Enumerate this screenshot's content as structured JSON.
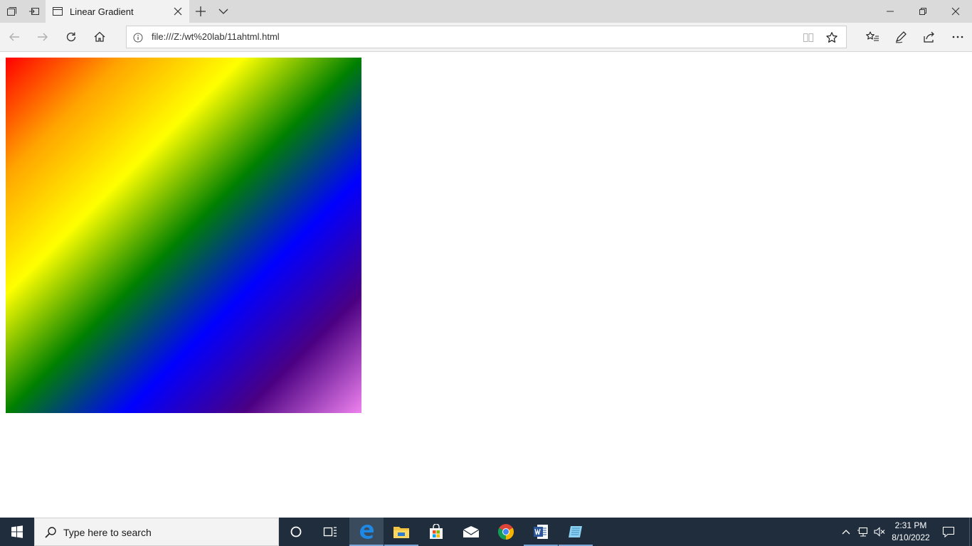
{
  "browser": {
    "tab": {
      "title": "Linear Gradient"
    },
    "address_bar": {
      "url": "file:///Z:/wt%20lab/11ahtml.html"
    }
  },
  "page": {
    "gradient_box": {
      "direction": "to bottom right",
      "colors": [
        "#ff0000",
        "#ffa500",
        "#ffff00",
        "#008000",
        "#0000ff",
        "#4b0082",
        "#ee82ee"
      ]
    }
  },
  "taskbar": {
    "search_placeholder": "Type here to search",
    "apps": [
      "cortana-icon",
      "task-view-icon",
      "edge-icon",
      "file-explorer-icon",
      "store-icon",
      "mail-icon",
      "chrome-icon",
      "word-icon",
      "notepad-icon"
    ],
    "clock": {
      "time": "2:31 PM",
      "date": "8/10/2022"
    }
  }
}
